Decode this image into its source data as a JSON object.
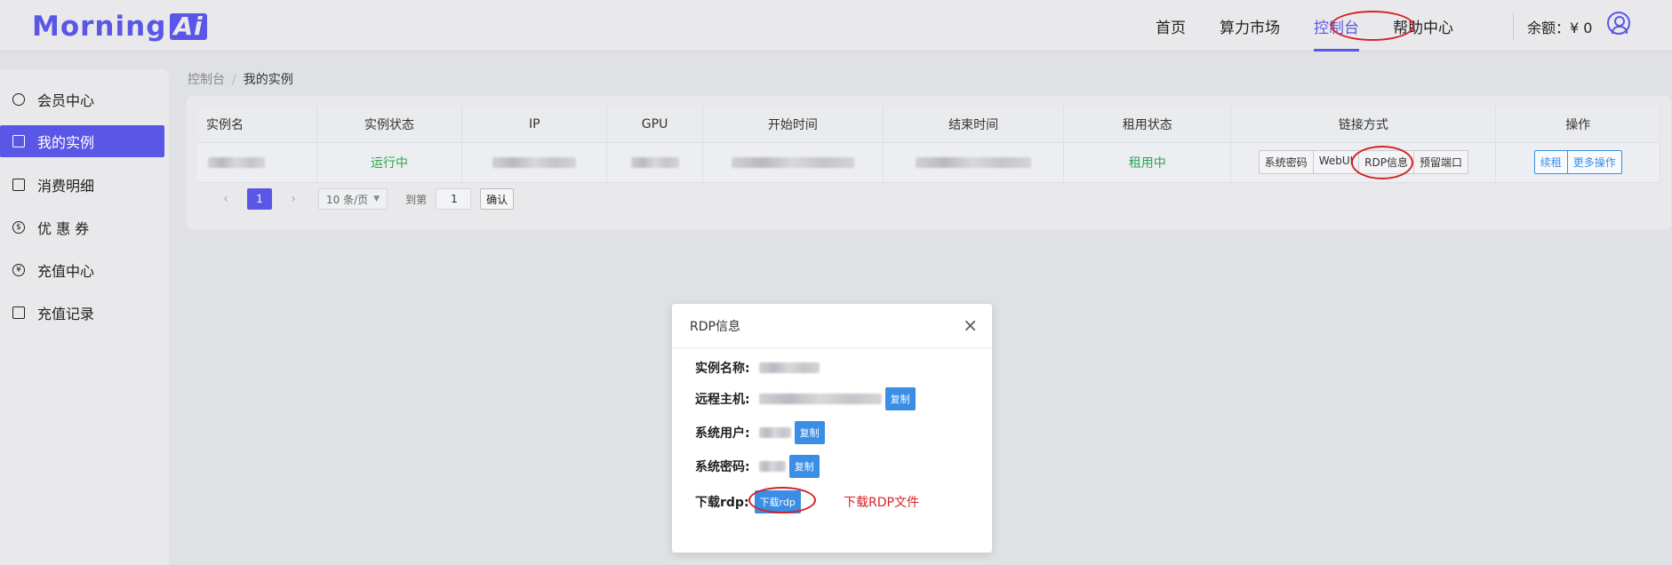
{
  "header": {
    "logo_text": "Morning",
    "logo_ai": "Ai",
    "nav": [
      "首页",
      "算力市场",
      "控制台",
      "帮助中心"
    ],
    "balance": "余额：¥ 0"
  },
  "sidebar": {
    "items": [
      {
        "label": "会员中心",
        "icon": "user-icon"
      },
      {
        "label": "我的实例",
        "icon": "cube-icon"
      },
      {
        "label": "消费明细",
        "icon": "document-icon"
      },
      {
        "label": "优 惠 券",
        "icon": "coupon-icon"
      },
      {
        "label": "充值中心",
        "icon": "yen-icon"
      },
      {
        "label": "充值记录",
        "icon": "clipboard-icon"
      }
    ]
  },
  "breadcrumb": {
    "root": "控制台",
    "sep": "/",
    "current": "我的实例"
  },
  "table": {
    "headers": [
      "实例名",
      "实例状态",
      "IP",
      "GPU",
      "开始时间",
      "结束时间",
      "租用状态",
      "链接方式",
      "操作"
    ],
    "row": {
      "status": "运行中",
      "rent_status": "租用中",
      "link_buttons": [
        "系统密码",
        "WebUI",
        "RDP信息",
        "预留端口"
      ],
      "action_buttons": [
        "续租",
        "更多操作"
      ]
    }
  },
  "pagination": {
    "prev": "‹",
    "page": "1",
    "next": "›",
    "page_size": "10 条/页",
    "goto_label": "到第",
    "goto_value": "1",
    "confirm": "确认"
  },
  "dialog": {
    "title": "RDP信息",
    "close": "×",
    "rows": [
      {
        "label": "实例名称:"
      },
      {
        "label": "远程主机:",
        "button": "复制"
      },
      {
        "label": "系统用户:",
        "button": "复制"
      },
      {
        "label": "系统密码:",
        "button": "复制"
      },
      {
        "label": "下载rdp:",
        "button": "下载rdp"
      }
    ],
    "annotation": "下载RDP文件"
  },
  "colors": {
    "accent": "#5b57e6",
    "annotation": "#d42222",
    "button_blue": "#3a8ee6",
    "status_green": "#2ea44f"
  }
}
